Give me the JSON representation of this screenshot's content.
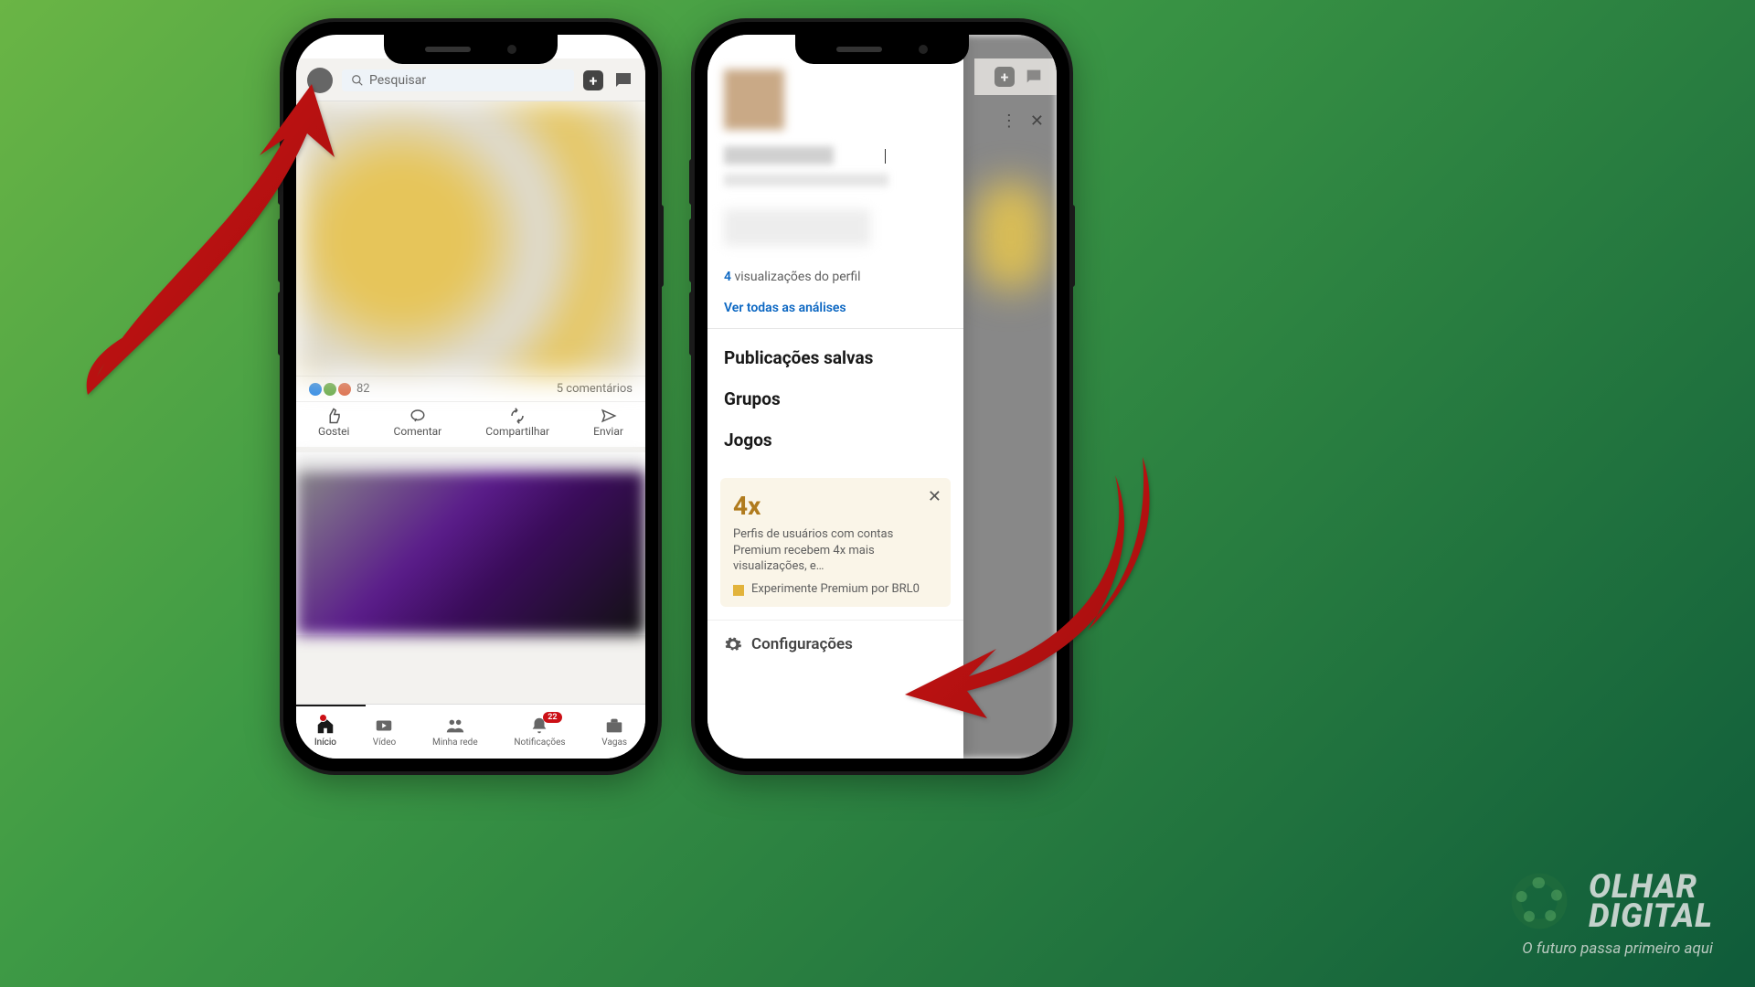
{
  "phone1": {
    "search_placeholder": "Pesquisar",
    "reactions_count": "82",
    "comments_count": "5 comentários",
    "actions": {
      "like": "Gostei",
      "comment": "Comentar",
      "share": "Compartilhar",
      "send": "Enviar"
    },
    "nav": {
      "home": "Início",
      "video": "Vídeo",
      "network": "Minha rede",
      "notif": "Notificações",
      "jobs": "Vagas",
      "notif_badge": "22"
    }
  },
  "phone2": {
    "views_count": "4",
    "views_label": " visualizações do perfil",
    "analytics_link": "Ver todas as análises",
    "menu": {
      "saved": "Publicações salvas",
      "groups": "Grupos",
      "games": "Jogos"
    },
    "promo": {
      "mult": "4x",
      "body": "Perfis de usuários com contas Premium recebem 4x mais visualizações, e…",
      "cta": "Experimente Premium por BRL0"
    },
    "settings": "Configurações"
  },
  "brand": {
    "name1": "OLHAR",
    "name2": "DIGITAL",
    "tagline": "O futuro passa primeiro aqui"
  }
}
